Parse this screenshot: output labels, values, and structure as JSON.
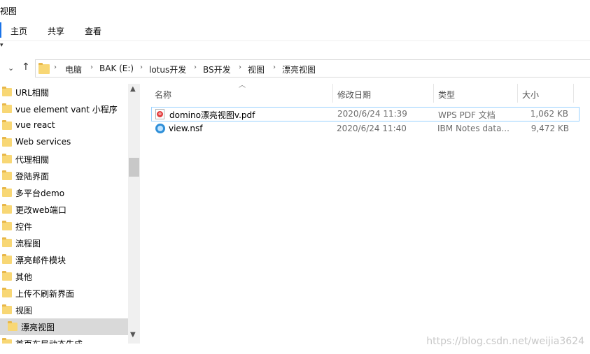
{
  "window": {
    "title": "视图"
  },
  "ribbon": {
    "tabs": [
      "主页",
      "共享",
      "查看"
    ]
  },
  "address": {
    "crumbs": [
      "电脑",
      "BAK (E:)",
      "lotus开发",
      "BS开发",
      "视图",
      "漂亮视图"
    ]
  },
  "nav": {
    "items": [
      "URL相關",
      "vue element vant 小程序",
      "vue react",
      "Web services",
      "代理相關",
      "登陆界面",
      "多平台demo",
      "更改web端口",
      "控件",
      "流程图",
      "漂亮邮件模块",
      "其他",
      "上传不刷新界面",
      "视图",
      "漂亮视图",
      "首页布局动态生成"
    ],
    "selected_index": 14
  },
  "columns": {
    "name": "名称",
    "date": "修改日期",
    "type": "类型",
    "size": "大小"
  },
  "files": [
    {
      "icon": "pdf-icon",
      "name": "domino漂亮视图v.pdf",
      "date": "2020/6/24 11:39",
      "type": "WPS PDF 文档",
      "size": "1,062 KB"
    },
    {
      "icon": "nsf-icon",
      "name": "view.nsf",
      "date": "2020/6/24 11:40",
      "type": "IBM Notes data...",
      "size": "9,472 KB"
    }
  ],
  "watermark": "https://blog.csdn.net/weijia3624"
}
